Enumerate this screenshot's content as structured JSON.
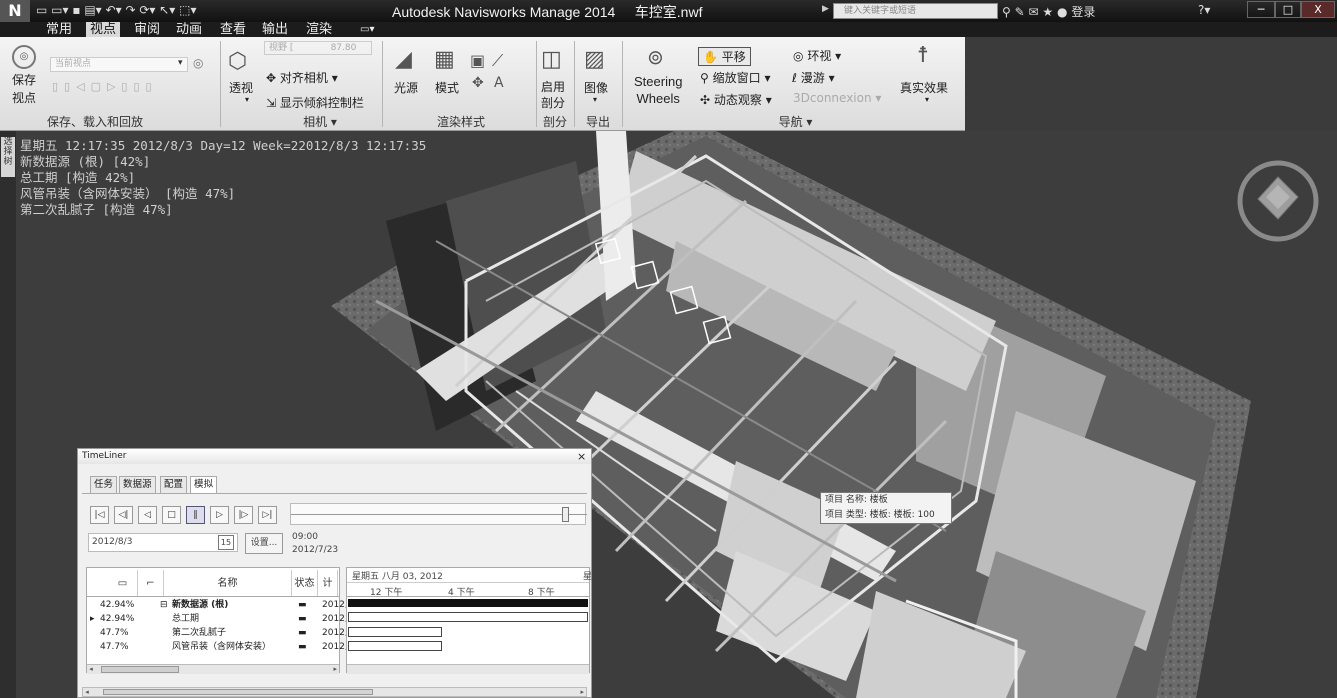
{
  "app": {
    "title": "Autodesk Navisworks Manage 2014",
    "file": "车控室.nwf",
    "search_placeholder": "键入关键字或短语",
    "login": "登录"
  },
  "menu": {
    "tabs": [
      "常用",
      "视点",
      "审阅",
      "动画",
      "查看",
      "输出",
      "渲染"
    ],
    "active": "视点"
  },
  "ribbon": {
    "save_viewpoint": "保存\n视点",
    "viewpoint_dropdown_placeholder": "当前视点",
    "panel_save": "保存、载入和回放",
    "perspective": "透视",
    "align_camera": "对齐相机",
    "show_tilt": "显示倾斜控制栏",
    "fov_value": "87.80",
    "panel_camera": "相机",
    "light": "光源",
    "mode": "模式",
    "panel_render_style": "渲染样式",
    "enable": "启用",
    "section": "剖分",
    "panel_section": "剖分",
    "image": "图像",
    "panel_export": "导出",
    "steering": "Steering",
    "wheels": "Wheels",
    "pan": "平移",
    "zoom_window": "缩放窗口",
    "orbit": "动态观察",
    "look_around": "环视",
    "walk": "漫游",
    "threedconnexion": "3Dconnexion",
    "realism": "真实效果",
    "panel_nav": "导航"
  },
  "side_tab": "选择树",
  "overlay": {
    "line1": "星期五 12:17:35 2012/8/3 Day=12 Week=22012/8/3 12:17:35",
    "line2": "新数据源 (根) [42%]",
    "line3": "总工期 [构造 42%]",
    "line4": "风管吊装（含网体安装） [构造 47%]",
    "line5": "第二次乱腻子 [构造 47%]"
  },
  "tooltip": {
    "line1": "项目 名称: 楼板",
    "line2": "项目 类型: 楼板: 楼板: 100"
  },
  "timeliner": {
    "title": "TimeLiner",
    "close": "×",
    "tabs": [
      "任务",
      "数据源",
      "配置",
      "模拟"
    ],
    "active_tab": "模拟",
    "date": "2012/8/3",
    "date_btn": "15",
    "settings": "设置...",
    "time": "09:00",
    "time_date": "2012/7/23",
    "col_name": "名称",
    "col_status": "状态",
    "col_plan": "计",
    "gantt_date": "星期五 八月 03, 2012",
    "gantt_date2": "星",
    "gantt_ticks": [
      "12 下午",
      "4 下午",
      "8 下午"
    ],
    "progress": 0.93,
    "rows": [
      {
        "pct": "42.94%",
        "name": "新数据源 (根)",
        "date": "2012,",
        "marker": "",
        "expander": "⊟"
      },
      {
        "pct": "42.94%",
        "name": "总工期",
        "date": "2012,",
        "marker": "▸",
        "expander": ""
      },
      {
        "pct": "47.7%",
        "name": "第二次乱腻子",
        "date": "2012,",
        "marker": "",
        "expander": ""
      },
      {
        "pct": "47.7%",
        "name": "风管吊装（含网体安装）",
        "date": "2012,",
        "marker": "",
        "expander": ""
      }
    ]
  }
}
